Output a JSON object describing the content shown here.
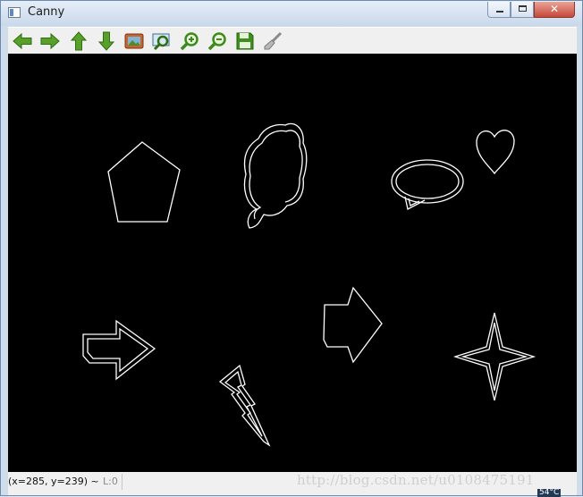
{
  "window": {
    "title": "Canny"
  },
  "titlebar": {
    "close_label": "✕"
  },
  "toolbar": {
    "buttons": [
      {
        "name": "pan-left-button",
        "icon": "arrow-left-icon"
      },
      {
        "name": "pan-right-button",
        "icon": "arrow-right-icon"
      },
      {
        "name": "pan-up-button",
        "icon": "arrow-up-icon"
      },
      {
        "name": "pan-down-button",
        "icon": "arrow-down-icon"
      },
      {
        "name": "zoom-fit-button",
        "icon": "image-icon"
      },
      {
        "name": "zoom-region-button",
        "icon": "magnify-region-icon"
      },
      {
        "name": "zoom-in-button",
        "icon": "zoom-in-icon"
      },
      {
        "name": "zoom-out-button",
        "icon": "zoom-out-icon"
      },
      {
        "name": "save-button",
        "icon": "floppy-disk-icon"
      },
      {
        "name": "properties-button",
        "icon": "brush-icon"
      }
    ],
    "accent": "#5aa02c"
  },
  "status": {
    "coords": "(x=285, y=239) ~",
    "level": "L:0"
  },
  "watermark": "http://blog.csdn.net/u0108475191",
  "tray": "54°C",
  "colors": {
    "canvas_bg": "#000000",
    "edge": "#ffffff"
  }
}
